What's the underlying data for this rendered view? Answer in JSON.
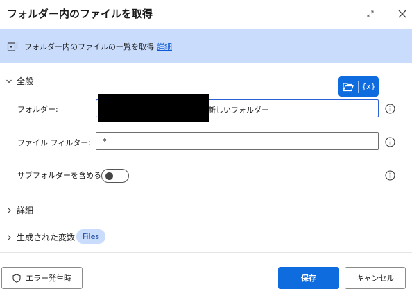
{
  "dialog": {
    "title": "フォルダー内のファイルを取得"
  },
  "banner": {
    "text": "フォルダー内のファイルの一覧を取得",
    "link": "詳細"
  },
  "sections": {
    "general": "全般",
    "details": "詳細",
    "variables": "生成された変数"
  },
  "fields": {
    "folder_label": "フォルダー:",
    "folder_value_visible": "新しいフォルダー",
    "filter_label": "ファイル フィルター:",
    "filter_value": "*",
    "subfolders_label": "サブフォルダーを含める:",
    "subfolders_on": false
  },
  "picker": {
    "variable_label": "{x}"
  },
  "variables": {
    "badge": "Files"
  },
  "footer": {
    "on_error": "エラー発生時",
    "save": "保存",
    "cancel": "キャンセル"
  },
  "colors": {
    "accent": "#0f6cde",
    "banner_bg": "#c9dcfb",
    "link": "#0f5ad6"
  }
}
